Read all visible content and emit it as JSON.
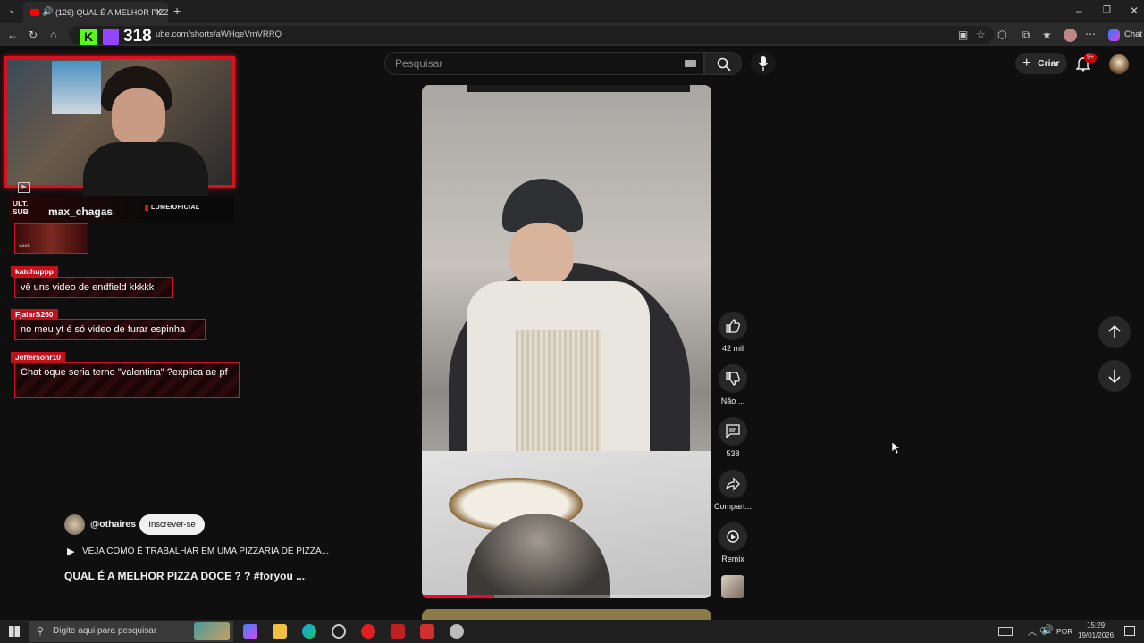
{
  "browser": {
    "tab_title": "(126) QUAL É A MELHOR PIZZ",
    "url": "ube.com/shorts/aWHqeVmVRRQ",
    "chat_label": "Chat",
    "kick_count": "318"
  },
  "youtube": {
    "search_placeholder": "Pesquisar",
    "create_label": "Criar",
    "notif_count": "9+",
    "actions": {
      "likes": "42 mil",
      "dislike": "Não ...",
      "comments": "538",
      "share": "Compart...",
      "remix": "Remix"
    },
    "channel": {
      "handle": "@othaires",
      "subscribe_label": "Inscrever-se"
    },
    "playlist_line": "VEJA COMO É TRABALHAR EM UMA PIZZARIA DE PIZZA...",
    "video_title": "QUAL É A MELHOR PIZZA DOCE ? ? #foryou ...",
    "progress": 0.25
  },
  "overlay": {
    "last_sub_label": "ULT. SUB",
    "last_sub_name": "max_chagas",
    "brand": "LUMEIOFICIAL",
    "avatar_caption": "você",
    "chat": [
      {
        "user": "katchuppp",
        "text": "vê uns video de endfield kkkkk"
      },
      {
        "user": "FjalarS260",
        "text": "no meu yt é só video de furar espinha"
      },
      {
        "user": "Jeffersonr10",
        "text": "Chat oque seria terno \"valentina\" ?explica ae pf"
      }
    ]
  },
  "taskbar": {
    "search_placeholder": "Digite aqui para pesquisar",
    "lang": "POR",
    "time": "15:29",
    "date": "19/01/2026"
  },
  "colors": {
    "accent_red": "#d6121f",
    "yt_bg": "#0f0f0f"
  }
}
